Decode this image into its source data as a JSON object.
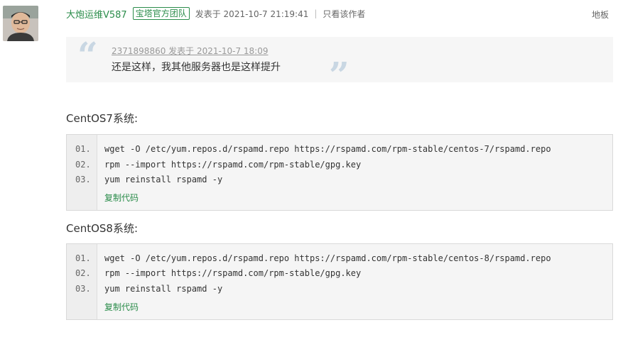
{
  "post": {
    "author": "大炮运维V587",
    "badge": "宝塔官方团队",
    "published": "发表于 2021-10-7 21:19:41",
    "separator": "|",
    "only_author": "只看该作者",
    "floor": "地板"
  },
  "quote": {
    "header": "2371898860 发表于 2021-10-7 18:09",
    "text": "还是这样，我其他服务器也是这样提升"
  },
  "sections": [
    {
      "title": "CentOS7系统:",
      "lines": [
        {
          "num": "01.",
          "code": "wget -O /etc/yum.repos.d/rspamd.repo https://rspamd.com/rpm-stable/centos-7/rspamd.repo"
        },
        {
          "num": "02.",
          "code": "rpm --import https://rspamd.com/rpm-stable/gpg.key"
        },
        {
          "num": "03.",
          "code": "yum reinstall rspamd -y"
        }
      ],
      "copy_label": "复制代码"
    },
    {
      "title": "CentOS8系统:",
      "lines": [
        {
          "num": "01.",
          "code": "wget -O /etc/yum.repos.d/rspamd.repo https://rspamd.com/rpm-stable/centos-8/rspamd.repo"
        },
        {
          "num": "02.",
          "code": "rpm --import https://rspamd.com/rpm-stable/gpg.key"
        },
        {
          "num": "03.",
          "code": "yum reinstall rspamd -y"
        }
      ],
      "copy_label": "复制代码"
    }
  ],
  "colors": {
    "accent_green": "#2a8c4a",
    "quote_bg": "#f6f6f6",
    "code_bg": "#f5f5f5"
  }
}
